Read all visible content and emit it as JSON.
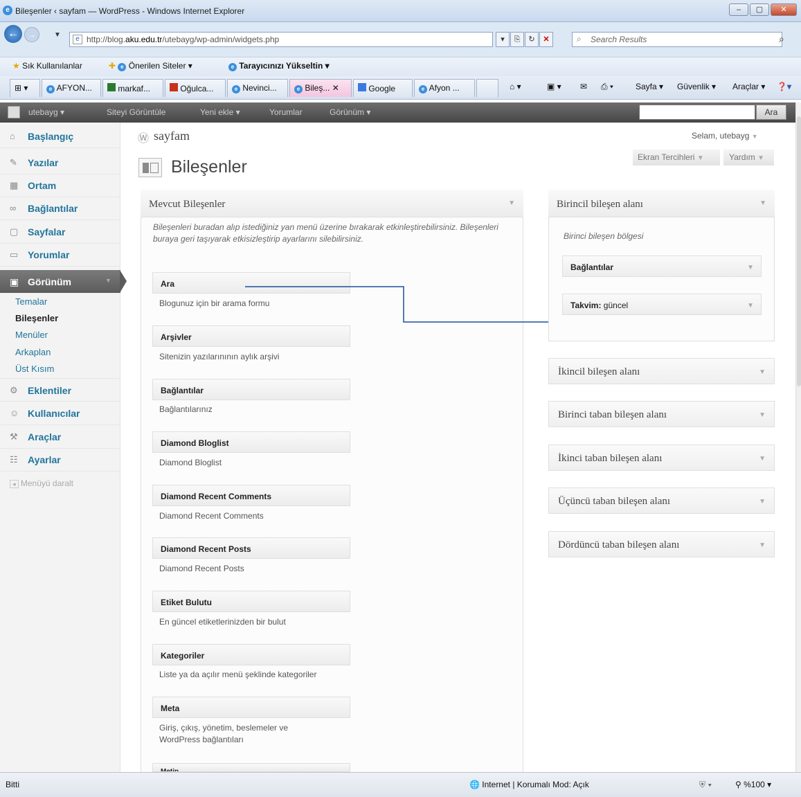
{
  "window": {
    "title": "Bileşenler ‹ sayfam — WordPress - Windows Internet Explorer"
  },
  "address": {
    "url_prefix": "http://blog.",
    "url_domain": "aku.edu.tr",
    "url_path": "/utebayg/wp-admin/widgets.php",
    "search_placeholder": "Search Results"
  },
  "favorites": {
    "label": "Sık Kullanılanlar",
    "items": [
      "Önerilen Siteler ▾",
      "Tarayıcınızı Yükseltin ▾"
    ]
  },
  "tabs": [
    "AFYON...",
    "markaf...",
    "Oğulca...",
    "Nevinci...",
    "Bileş... ✕",
    "Google",
    "Afyon ..."
  ],
  "ie_tools": [
    "Sayfa ▾",
    "Güvenlik ▾",
    "Araçlar ▾"
  ],
  "wp_bar": {
    "user": "utebayg ▾",
    "items": [
      "Siteyi Görüntüle",
      "Yeni ekle ▾",
      "Yorumlar",
      "Görünüm ▾"
    ],
    "search_button": "Ara"
  },
  "sidebar": {
    "menu": [
      "Başlangıç",
      "Yazılar",
      "Ortam",
      "Bağlantılar",
      "Sayfalar",
      "Yorumlar"
    ],
    "active": "Görünüm",
    "sub": [
      "Temalar",
      "Bileşenler",
      "Menüler",
      "Arkaplan",
      "Üst Kısım"
    ],
    "menu2": [
      "Eklentiler",
      "Kullanıcılar",
      "Araçlar",
      "Ayarlar"
    ],
    "collapse": "Menüyü daralt"
  },
  "header": {
    "site": "sayfam",
    "greeting": "Selam, utebayg",
    "screen_options": "Ekran Tercihleri",
    "help": "Yardım",
    "page_title": "Bileşenler"
  },
  "available": {
    "title": "Mevcut Bileşenler",
    "description": "Bileşenleri buradan alıp istediğiniz yan menü üzerine bırakarak etkinleştirebilirsiniz. Bileşenleri buraya geri taşıyarak etkisizleştirip ayarlarını silebilirsiniz.",
    "widgets": [
      {
        "name": "Ara",
        "desc": "Blogunuz için bir arama formu"
      },
      {
        "name": "Arşivler",
        "desc": "Sitenizin yazılarınının aylık arşivi"
      },
      {
        "name": "Bağlantılar",
        "desc": "Bağlantılarınız"
      },
      {
        "name": "Diamond Bloglist",
        "desc": "Diamond Bloglist"
      },
      {
        "name": "Diamond Recent Comments",
        "desc": "Diamond Recent Comments"
      },
      {
        "name": "Diamond Recent Posts",
        "desc": "Diamond Recent Posts"
      },
      {
        "name": "Etiket Bulutu",
        "desc": "En güncel etiketlerinizden bir bulut"
      },
      {
        "name": "Kategoriler",
        "desc": "Liste ya da açılır menü şeklinde kategoriler"
      },
      {
        "name": "Meta",
        "desc": "Giriş, çıkış, yönetim, beslemeler ve WordPress bağlantıları"
      },
      {
        "name": "Metin",
        "desc": ""
      }
    ]
  },
  "primary": {
    "title": "Birincil bileşen alanı",
    "desc": "Birinci bileşen bölgesi",
    "widgets": [
      {
        "name": "Bağlantılar",
        "sub": ""
      },
      {
        "name": "Takvim:",
        "sub": " güncel"
      }
    ]
  },
  "areas": [
    "İkincil bileşen alanı",
    "Birinci taban bileşen alanı",
    "İkinci taban bileşen alanı",
    "Üçüncü taban bileşen alanı",
    "Dördüncü taban bileşen alanı"
  ],
  "status": {
    "left": "Bitti",
    "zone": "Internet | Korumalı Mod: Açık",
    "zoom": "%100"
  }
}
